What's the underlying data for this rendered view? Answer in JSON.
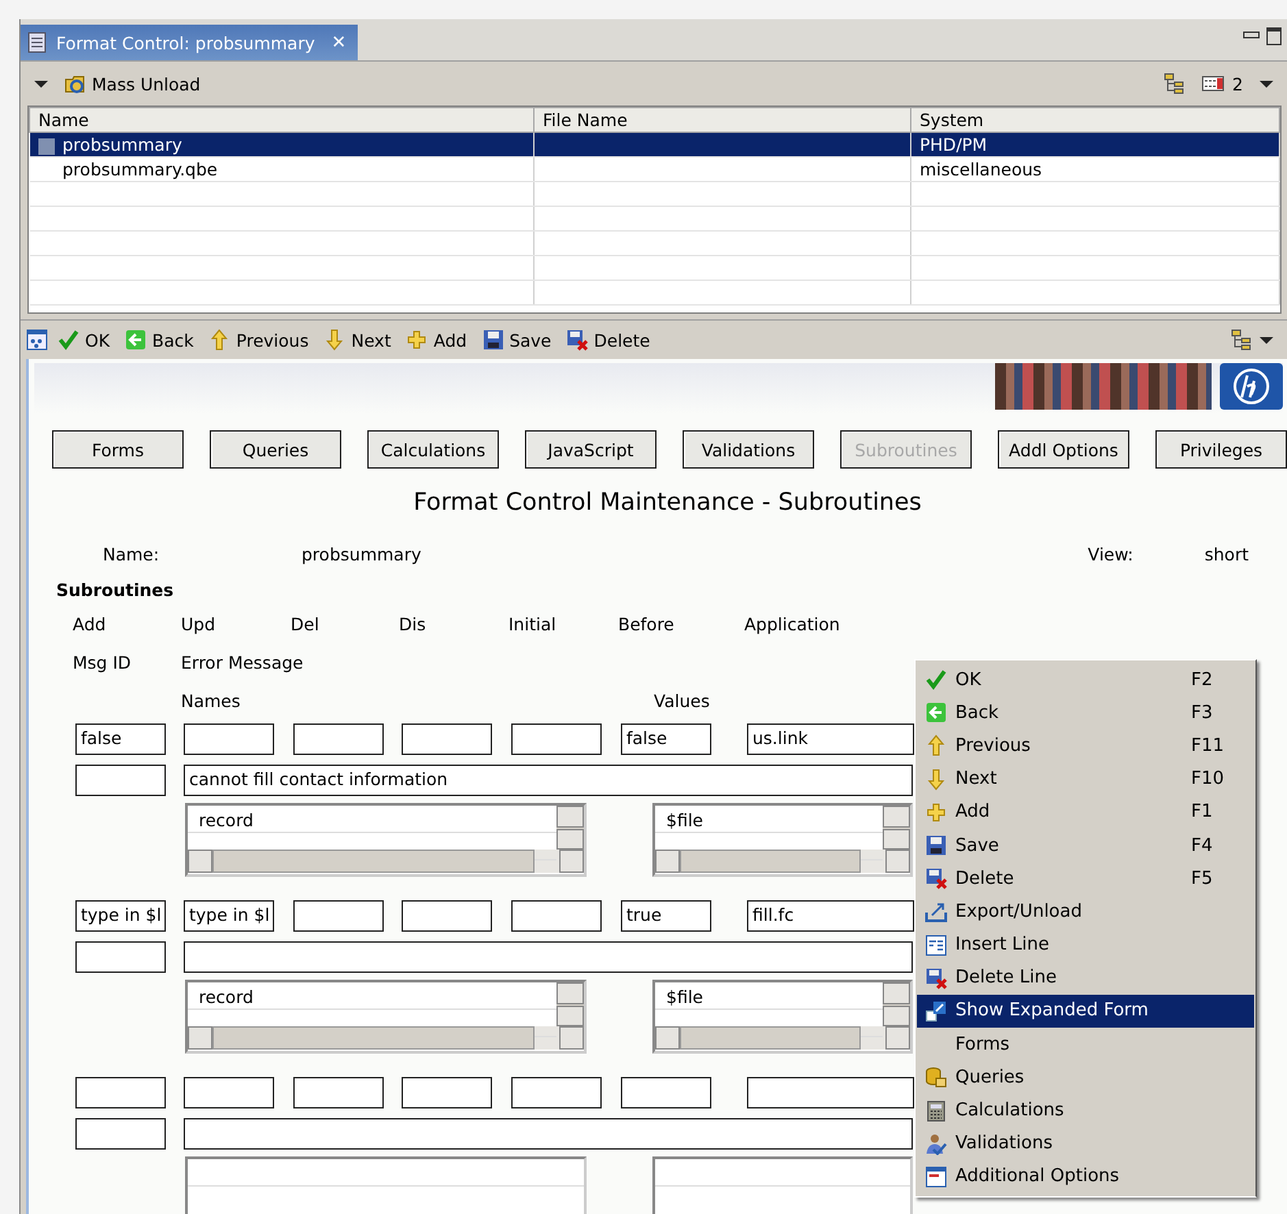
{
  "editor_tab": {
    "title": "Format Control: probsummary",
    "close": "✕",
    "selected": true
  },
  "toolbar": {
    "button": "Mass Unload",
    "count": "2"
  },
  "table": {
    "columns": [
      "Name",
      "File Name",
      "System"
    ],
    "rows": [
      {
        "cells": [
          "probsummary",
          "",
          "PHD/PM"
        ],
        "selected": true
      },
      {
        "cells": [
          "probsummary.qbe",
          "",
          "miscellaneous"
        ],
        "selected": false
      }
    ]
  },
  "actions": [
    {
      "label": "OK"
    },
    {
      "label": "Back"
    },
    {
      "label": "Previous"
    },
    {
      "label": "Next"
    },
    {
      "label": "Add"
    },
    {
      "label": "Save"
    },
    {
      "label": "Delete"
    }
  ],
  "nav_buttons": [
    {
      "label": "Forms",
      "disabled": false
    },
    {
      "label": "Queries",
      "disabled": false
    },
    {
      "label": "Calculations",
      "disabled": false
    },
    {
      "label": "JavaScript",
      "disabled": false
    },
    {
      "label": "Validations",
      "disabled": false
    },
    {
      "label": "Subroutines",
      "disabled": true
    },
    {
      "label": "Addl Options",
      "disabled": false
    },
    {
      "label": "Privileges",
      "disabled": false
    }
  ],
  "page_title": "Format Control Maintenance - Subroutines",
  "name_label": "Name:",
  "name_value": "probsummary",
  "view_label": "View:",
  "view_value": "short",
  "section_title": "Subroutines",
  "column_labels": [
    "Add",
    "Upd",
    "Del",
    "Dis",
    "Initial",
    "Before",
    "Application"
  ],
  "row2_labels": [
    "Msg ID",
    "Error Message"
  ],
  "row3_labels": [
    "Names",
    "Values"
  ],
  "records": [
    {
      "add": "false",
      "before": "false",
      "application": "us.link",
      "error_message": "cannot fill contact information",
      "names": [
        "record"
      ],
      "values": [
        "$file"
      ]
    },
    {
      "add": "type in $l",
      "upd": "type in $l",
      "before": "true",
      "application": "fill.fc",
      "names": [
        "record"
      ],
      "values": [
        "$file"
      ]
    }
  ],
  "context_menu": [
    {
      "label": "OK",
      "shortcut": "F2",
      "selected": false
    },
    {
      "label": "Back",
      "shortcut": "F3",
      "selected": false
    },
    {
      "label": "Previous",
      "shortcut": "F11",
      "selected": false
    },
    {
      "label": "Next",
      "shortcut": "F10",
      "selected": false
    },
    {
      "label": "Add",
      "shortcut": "F1",
      "selected": false
    },
    {
      "label": "Save",
      "shortcut": "F4",
      "selected": false
    },
    {
      "label": "Delete",
      "shortcut": "F5",
      "selected": false
    },
    {
      "label": "Export/Unload",
      "selected": false
    },
    {
      "label": "Insert Line",
      "selected": false
    },
    {
      "label": "Delete Line",
      "selected": false
    },
    {
      "label": "Show Expanded Form",
      "selected": true
    },
    {
      "label": "Forms",
      "selected": false
    },
    {
      "label": "Queries",
      "selected": false
    },
    {
      "label": "Calculations",
      "selected": false
    },
    {
      "label": "Validations",
      "selected": false
    },
    {
      "label": "Additional Options",
      "selected": false
    }
  ]
}
